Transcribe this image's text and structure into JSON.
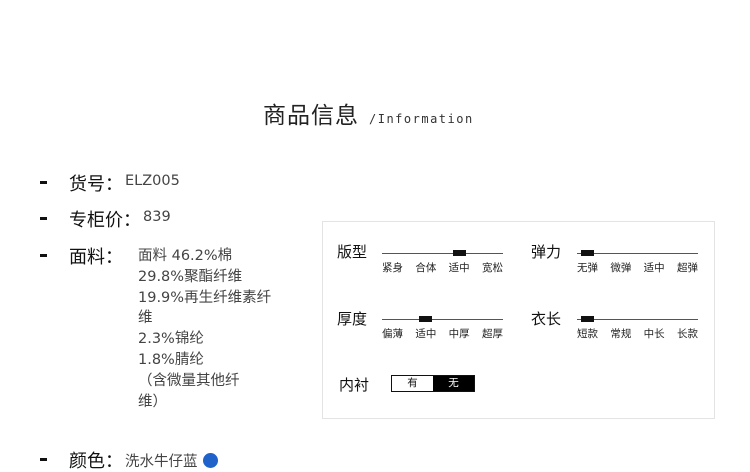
{
  "heading": {
    "title": "商品信息",
    "subtitle": "/Information"
  },
  "info": {
    "item_no": {
      "label": "货号：",
      "value": "ELZ005"
    },
    "price": {
      "label": "专柜价：",
      "value": "839"
    },
    "fabric": {
      "label": "面料：",
      "lines": [
        "面料 46.2%棉",
        "29.8%聚酯纤维",
        "19.9%再生纤维素纤",
        "维",
        "2.3%锦纶",
        "1.8%腈纶",
        "（含微量其他纤",
        "维）"
      ]
    },
    "color": {
      "label": "颜色：",
      "value": "洗水牛仔蓝",
      "swatch": "#1f62c9"
    }
  },
  "attributes": {
    "fit": {
      "title": "版型",
      "options": [
        "紧身",
        "合体",
        "适中",
        "宽松"
      ],
      "selected": "适中"
    },
    "elasticity": {
      "title": "弹力",
      "options": [
        "无弹",
        "微弹",
        "适中",
        "超弹"
      ],
      "selected": "无弹"
    },
    "thickness": {
      "title": "厚度",
      "options": [
        "偏薄",
        "适中",
        "中厚",
        "超厚"
      ],
      "selected": "适中"
    },
    "length": {
      "title": "衣长",
      "options": [
        "短款",
        "常规",
        "中长",
        "长款"
      ],
      "selected": "短款"
    },
    "lining": {
      "title": "内衬",
      "options": [
        "有",
        "无"
      ],
      "selected": "无"
    }
  }
}
